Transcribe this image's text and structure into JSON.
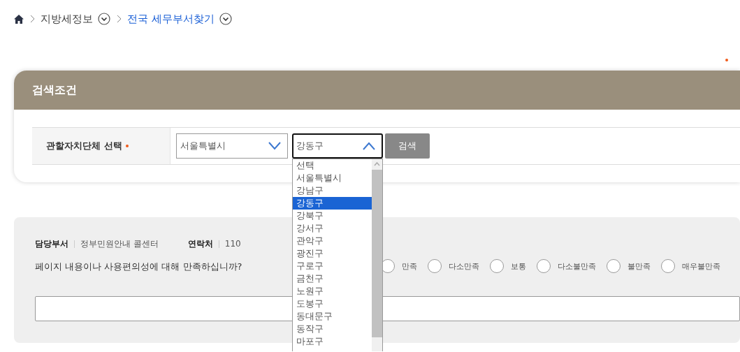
{
  "breadcrumb": [
    {
      "label": "지방세정보",
      "current": false
    },
    {
      "label": "전국 세무부서찾기",
      "current": true
    }
  ],
  "required_note": {
    "mark": true
  },
  "search": {
    "title": "검색조건",
    "field_label": "관할자치단체 선택",
    "required": true,
    "selects": [
      {
        "value": "서울특별시",
        "expanded": false
      },
      {
        "value": "강동구",
        "expanded": true,
        "options": [
          {
            "label": "선택",
            "selected": false
          },
          {
            "label": "서울특별시",
            "selected": false
          },
          {
            "label": "강남구",
            "selected": false
          },
          {
            "label": "강동구",
            "selected": true
          },
          {
            "label": "강북구",
            "selected": false
          },
          {
            "label": "강서구",
            "selected": false
          },
          {
            "label": "관악구",
            "selected": false
          },
          {
            "label": "광진구",
            "selected": false
          },
          {
            "label": "구로구",
            "selected": false
          },
          {
            "label": "금천구",
            "selected": false
          },
          {
            "label": "노원구",
            "selected": false
          },
          {
            "label": "도봉구",
            "selected": false
          },
          {
            "label": "동대문구",
            "selected": false
          },
          {
            "label": "동작구",
            "selected": false
          },
          {
            "label": "마포구",
            "selected": false
          }
        ]
      }
    ],
    "button": "검색"
  },
  "contact": {
    "dept_label": "담당부서",
    "dept": "정부민원안내 콜센터",
    "phone_label": "연락처",
    "phone": "110"
  },
  "survey": {
    "question": "페이지 내용이나 사용편의성에 대해 만족하십니까?",
    "options": [
      {
        "label": "만족",
        "selected": false
      },
      {
        "label": "다소만족",
        "selected": false
      },
      {
        "label": "보통",
        "selected": false
      },
      {
        "label": "다소불만족",
        "selected": false
      },
      {
        "label": "불만족",
        "selected": false
      },
      {
        "label": "매우불만족",
        "selected": false
      }
    ]
  }
}
